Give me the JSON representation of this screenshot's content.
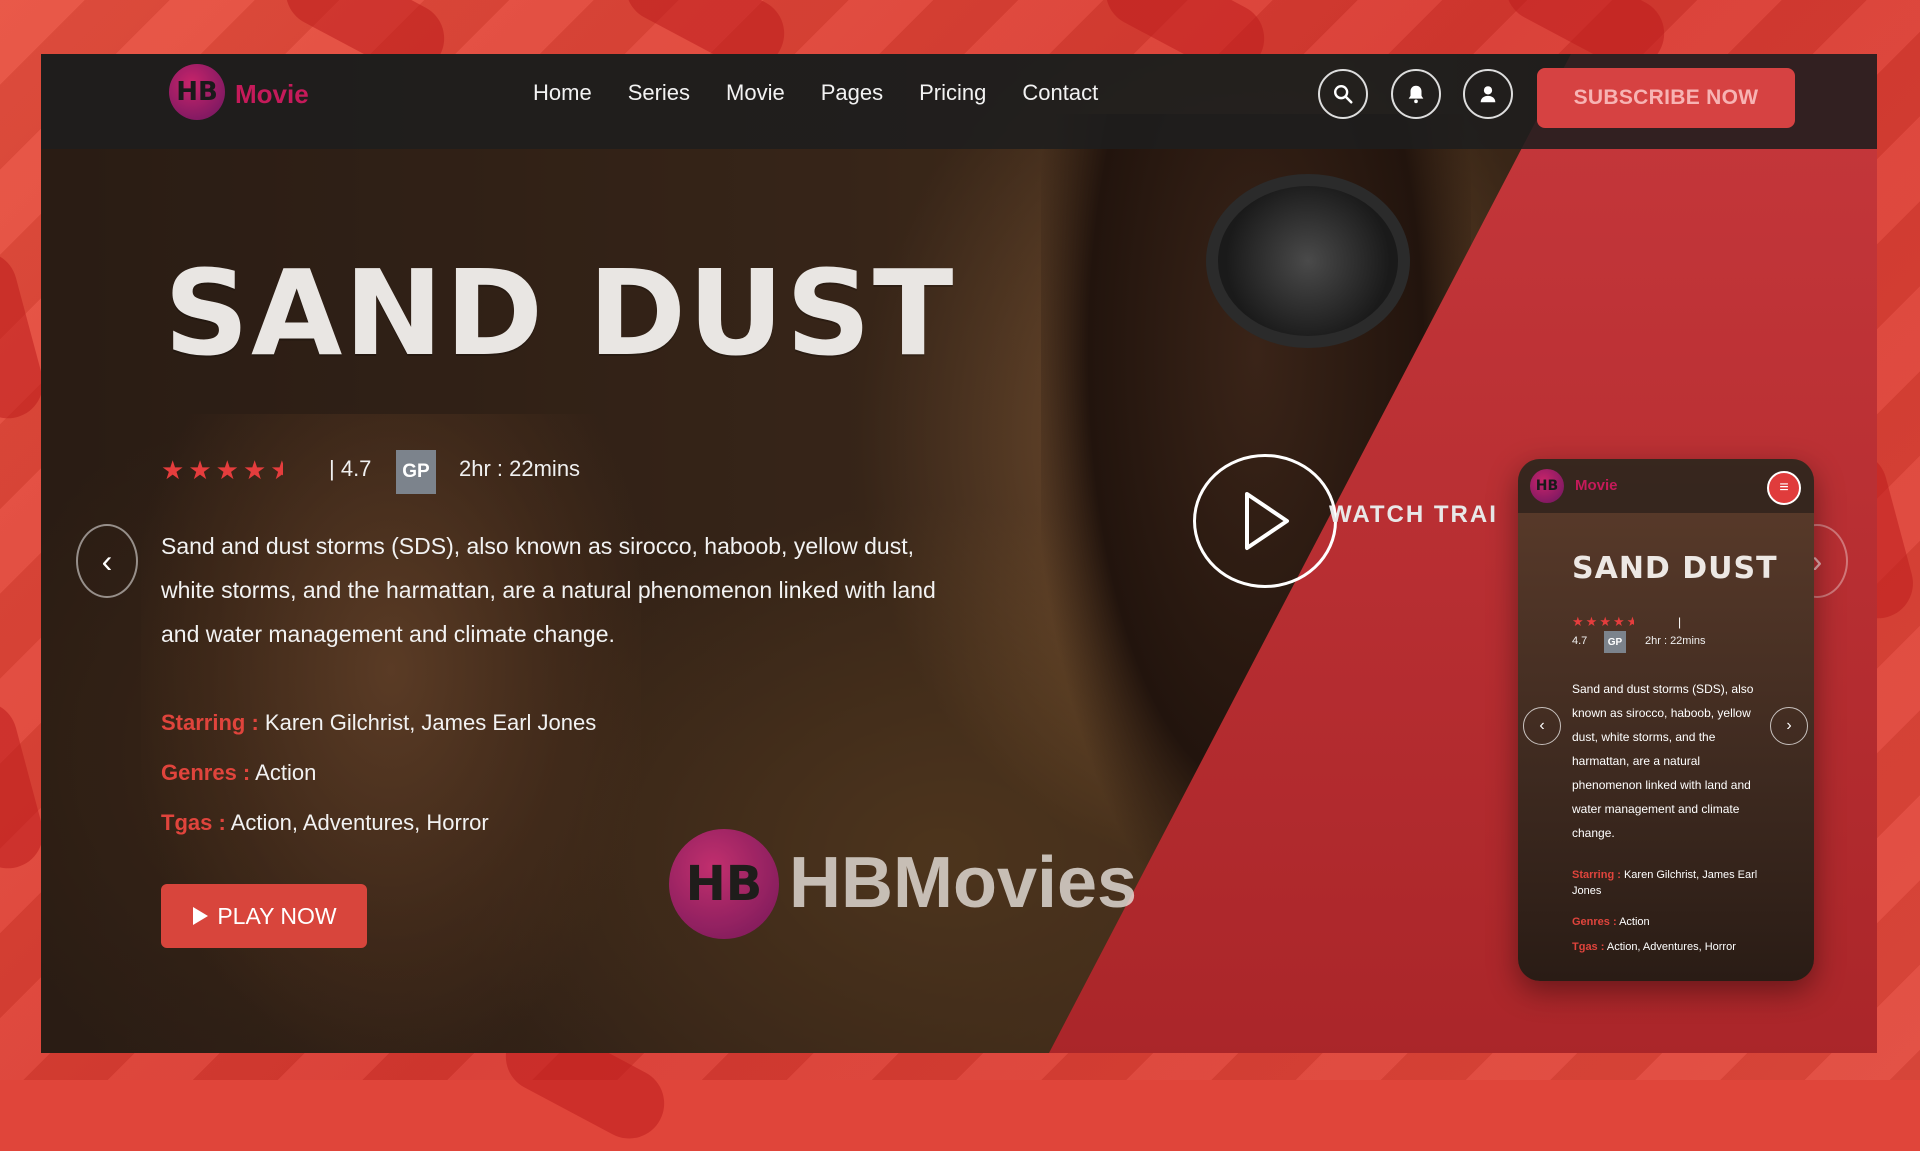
{
  "brand": {
    "logo_initials": "HB",
    "name": "Movie"
  },
  "nav": {
    "links": [
      "Home",
      "Series",
      "Movie",
      "Pages",
      "Pricing",
      "Contact"
    ],
    "subscribe_label": "SUBSCRIBE NOW",
    "icons": [
      "search-icon",
      "bell-icon",
      "user-icon"
    ]
  },
  "hero": {
    "title": "SAND DUST",
    "rating_text": "| 4.7",
    "rating_value": 4.7,
    "stars": 4.5,
    "certificate": "GP",
    "duration": "2hr : 22mins",
    "description": "Sand and dust storms (SDS), also known as sirocco, haboob, yellow dust, white storms, and the harmattan, are a natural phenomenon linked with land and water management and climate change.",
    "starring_label": "Starring :",
    "starring_value": "Karen Gilchrist, James Earl Jones",
    "genres_label": "Genres :",
    "genres_value": "Action",
    "tags_label": "Tgas :",
    "tags_value": "Action, Adventures, Horror",
    "play_label": "PLAY NOW",
    "watch_label": "WATCH TRAI"
  },
  "watermark": {
    "initials": "HB",
    "text": "HBMovies"
  },
  "mobile": {
    "logo_initials": "HB",
    "brand_name": "Movie",
    "title": "SAND DUST",
    "bar": "|",
    "rating": "4.7",
    "certificate": "GP",
    "duration": "2hr : 22mins",
    "description": "Sand and dust storms (SDS), also known as sirocco, haboob, yellow dust, white storms, and the harmattan, are a natural phenomenon linked with land and water management and climate change.",
    "starring_label": "Starring :",
    "starring_value": "Karen Gilchrist, James Earl Jones",
    "genres_label": "Genres :",
    "genres_value": "Action",
    "tags_label": "Tgas :",
    "tags_value": "Action, Adventures, Horror"
  },
  "colors": {
    "accent": "#d8453c",
    "brand": "#c51a5a",
    "frame": "#e0453a",
    "label_red": "#e0443c"
  }
}
